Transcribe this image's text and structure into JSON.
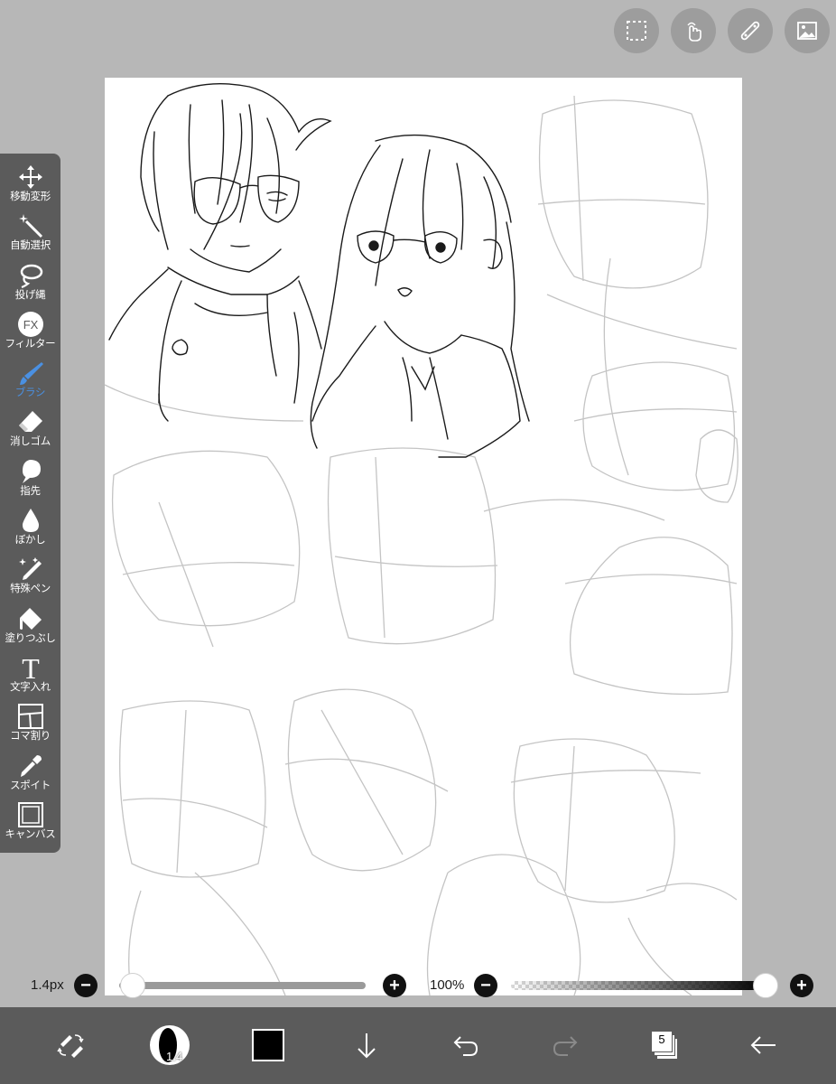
{
  "top_buttons": [
    {
      "name": "selection-icon"
    },
    {
      "name": "touch-gesture-icon"
    },
    {
      "name": "ruler-icon"
    },
    {
      "name": "image-icon"
    }
  ],
  "toolbar": {
    "tools": [
      {
        "id": "move",
        "label": "移動変形",
        "icon": "move-arrows-icon"
      },
      {
        "id": "magic",
        "label": "自動選択",
        "icon": "magic-wand-icon"
      },
      {
        "id": "lasso",
        "label": "投げ縄",
        "icon": "lasso-icon"
      },
      {
        "id": "filter",
        "label": "フィルター",
        "icon": "fx-icon",
        "icon_text": "FX"
      },
      {
        "id": "brush",
        "label": "ブラシ",
        "icon": "brush-icon",
        "active": true
      },
      {
        "id": "eraser",
        "label": "消しゴム",
        "icon": "eraser-icon"
      },
      {
        "id": "finger",
        "label": "指先",
        "icon": "finger-icon"
      },
      {
        "id": "blur",
        "label": "ぼかし",
        "icon": "blur-drop-icon"
      },
      {
        "id": "special",
        "label": "特殊ペン",
        "icon": "special-pen-icon"
      },
      {
        "id": "fill",
        "label": "塗りつぶし",
        "icon": "bucket-icon"
      },
      {
        "id": "text",
        "label": "文字入れ",
        "icon": "text-icon",
        "icon_text": "T"
      },
      {
        "id": "frame",
        "label": "コマ割り",
        "icon": "frame-divider-icon"
      },
      {
        "id": "picker",
        "label": "スポイト",
        "icon": "eyedropper-icon"
      },
      {
        "id": "canvas",
        "label": "キャンバス",
        "icon": "canvas-icon"
      }
    ],
    "active_color": "#4a90e2"
  },
  "brush_size": {
    "label": "1.4px",
    "value": 0.02
  },
  "opacity": {
    "label": "100%",
    "value": 1.0
  },
  "bottom": {
    "brush_preview_value": "1.4",
    "current_color": "#000000",
    "layer_count": "5"
  }
}
